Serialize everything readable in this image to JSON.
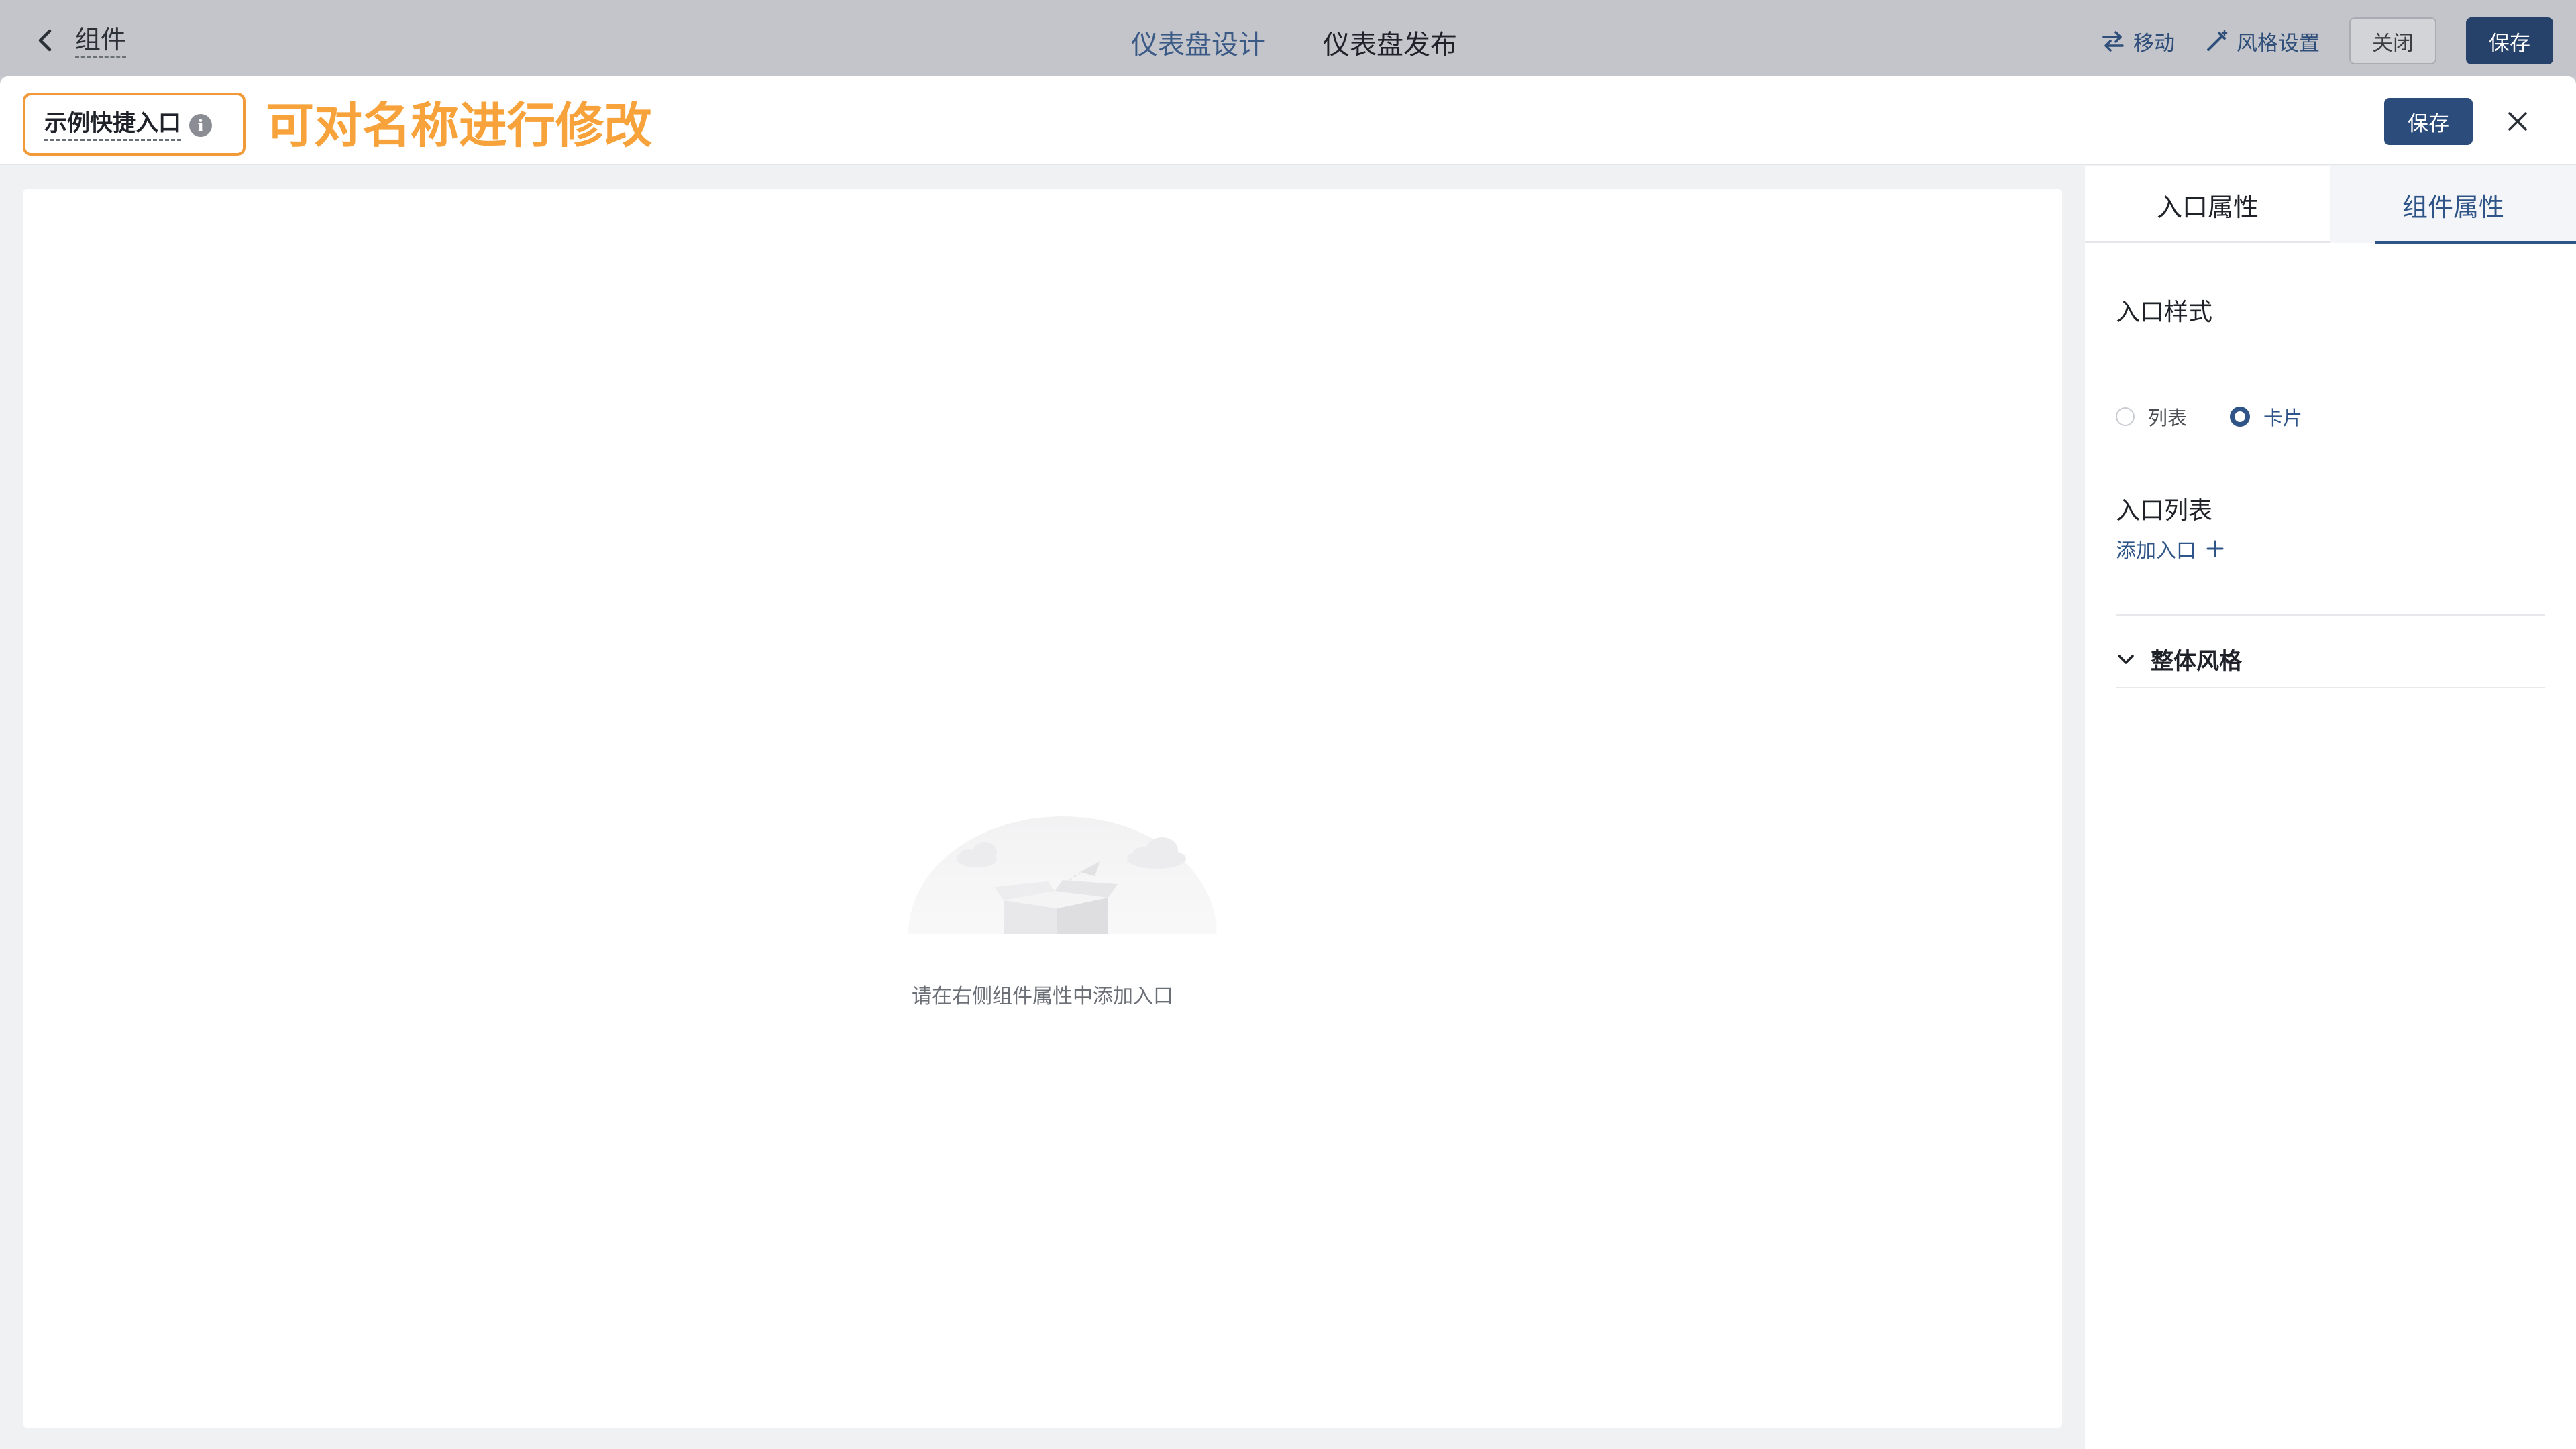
{
  "topbar": {
    "back_label": "组件",
    "tabs": [
      "仪表盘设计",
      "仪表盘发布"
    ],
    "actions": {
      "move": "移动",
      "style": "风格设置",
      "close": "关闭",
      "save": "保存"
    }
  },
  "modal": {
    "name": "示例快捷入口",
    "annotation": "可对名称进行修改",
    "save": "保存",
    "empty_text": "请在右侧组件属性中添加入口"
  },
  "panel": {
    "tabs": [
      "入口属性",
      "组件属性"
    ],
    "active_tab": "组件属性",
    "entry_style_title": "入口样式",
    "radio_list": "列表",
    "radio_card": "卡片",
    "selected_style": "卡片",
    "entry_list_title": "入口列表",
    "add_entry": "添加入口",
    "overall_style": "整体风格"
  },
  "colors": {
    "primary": "#2c4d7c",
    "annotation": "#f7a23a",
    "highlight_border": "#f29a3a"
  }
}
